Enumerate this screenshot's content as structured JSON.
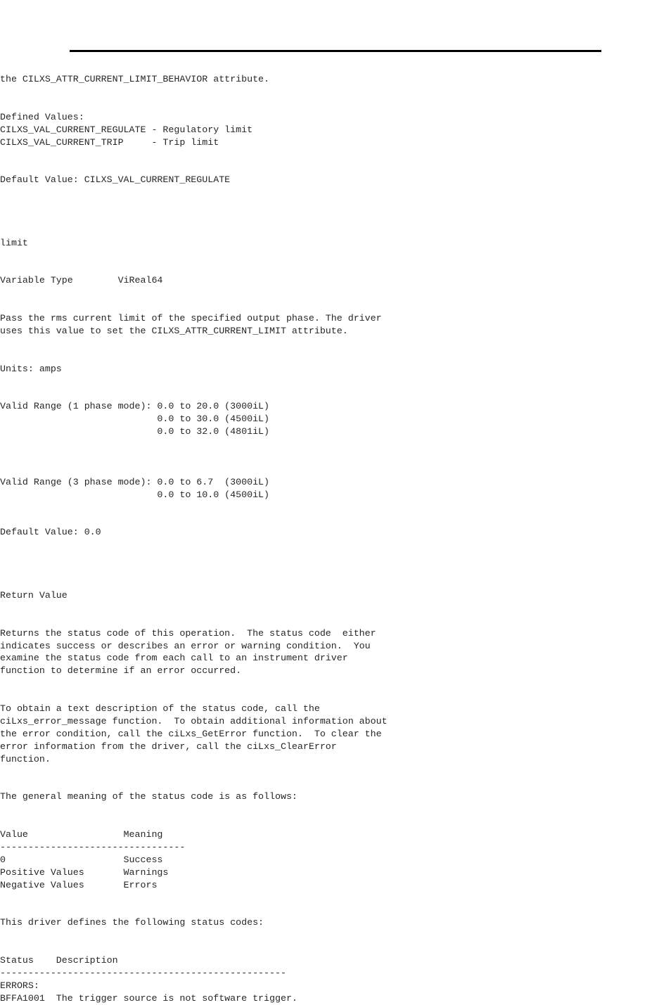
{
  "document": {
    "type": "api-reference-page",
    "rule_color": "#000000"
  },
  "sections": {
    "attribute_note": {
      "lines": [
        "the CILXS_ATTR_CURRENT_LIMIT_BEHAVIOR attribute."
      ]
    },
    "defined_values": {
      "lines": [
        "Defined Values:",
        "CILXS_VAL_CURRENT_REGULATE - Regulatory limit",
        "CILXS_VAL_CURRENT_TRIP     - Trip limit"
      ]
    },
    "behavior_default": {
      "lines": [
        "Default Value: CILXS_VAL_CURRENT_REGULATE"
      ]
    },
    "param_limit": {
      "name": "limit",
      "variable_type_line": "Variable Type        ViReal64",
      "description_lines": [
        "Pass the rms current limit of the specified output phase. The driver",
        "uses this value to set the CILXS_ATTR_CURRENT_LIMIT attribute."
      ],
      "units_line": "Units: amps",
      "valid_range_1phase_lines": [
        "Valid Range (1 phase mode): 0.0 to 20.0 (3000iL)",
        "                            0.0 to 30.0 (4500iL)",
        "                            0.0 to 32.0 (4801iL)"
      ],
      "valid_range_3phase_lines": [
        "Valid Range (3 phase mode): 0.0 to 6.7  (3000iL)",
        "                            0.0 to 10.0 (4500iL)"
      ],
      "default_line": "Default Value: 0.0"
    },
    "return_value": {
      "heading": "Return Value",
      "paragraph_1_lines": [
        "Returns the status code of this operation.  The status code  either",
        "indicates success or describes an error or warning condition.  You",
        "examine the status code from each call to an instrument driver",
        "function to determine if an error occurred."
      ],
      "paragraph_2_lines": [
        "To obtain a text description of the status code, call the",
        "ciLxs_error_message function.  To obtain additional information about",
        "the error condition, call the ciLxs_GetError function.  To clear the",
        "error information from the driver, call the ciLxs_ClearError",
        "function."
      ],
      "paragraph_3_lines": [
        "The general meaning of the status code is as follows:"
      ],
      "meaning_table": {
        "header_line": "Value                 Meaning",
        "separator_line": "---------------------------------",
        "rows": [
          "0                     Success",
          "Positive Values       Warnings",
          "Negative Values       Errors"
        ]
      },
      "paragraph_4_lines": [
        "This driver defines the following status codes:"
      ],
      "status_table": {
        "header_line": "Status    Description",
        "separator_line": "---------------------------------------------------",
        "group_label": "ERRORS:",
        "rows": [
          "BFFA1001  The trigger source is not software trigger."
        ]
      }
    }
  }
}
